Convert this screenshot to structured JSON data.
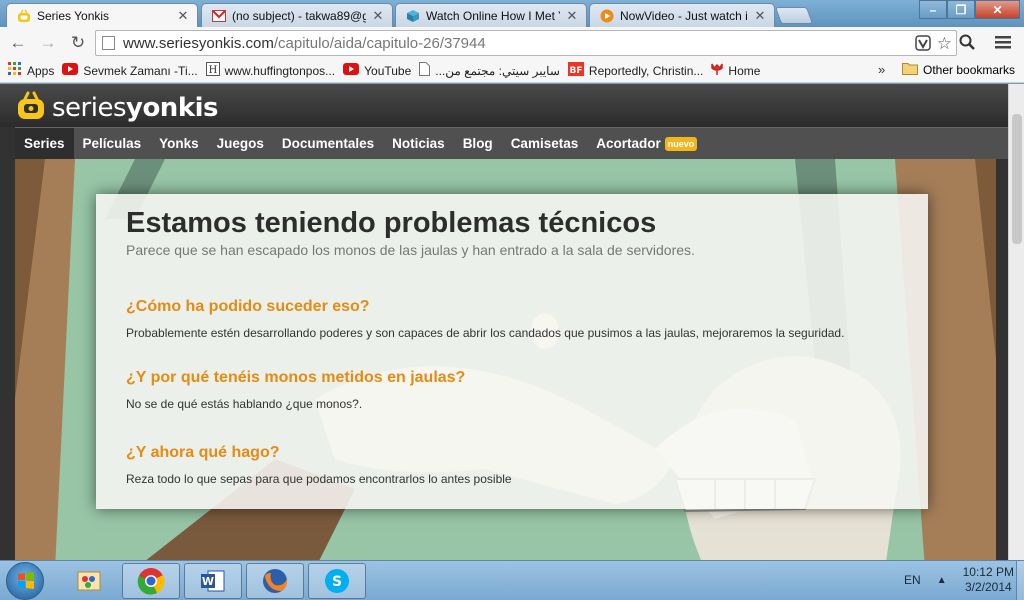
{
  "browser": {
    "tabs": [
      {
        "title": "Series Yonkis",
        "icon": "seriesyonkis-favicon",
        "active": true
      },
      {
        "title": "(no subject) - takwa89@g",
        "icon": "gmail-icon",
        "active": false
      },
      {
        "title": "Watch Online How I Met Y",
        "icon": "box-icon",
        "active": false
      },
      {
        "title": "NowVideo - Just watch it",
        "icon": "play-icon",
        "active": false
      }
    ],
    "url_host": "www.seriesyonkis.com",
    "url_path": "/capitulo/aida/capitulo-26/37944",
    "bookmarks": [
      {
        "label": "Apps",
        "icon": "apps-grid-icon"
      },
      {
        "label": "Sevmek Zamanı -Ti...",
        "icon": "youtube-icon"
      },
      {
        "label": "www.huffingtonpos...",
        "icon": "huffpost-icon"
      },
      {
        "label": "YouTube",
        "icon": "youtube-icon"
      },
      {
        "label": "سايبر سيتي: مجتمع من...",
        "icon": "page-icon"
      },
      {
        "label": "Reportedly, Christin...",
        "icon": "bf-icon"
      },
      {
        "label": "Home",
        "icon": "tulip-icon"
      }
    ],
    "bookmarks_overflow": "»",
    "other_bookmarks": "Other bookmarks"
  },
  "site": {
    "logo_light": "series",
    "logo_bold": "yonkis",
    "nav": [
      {
        "label": "Series",
        "active": true
      },
      {
        "label": "Películas"
      },
      {
        "label": "Yonks"
      },
      {
        "label": "Juegos"
      },
      {
        "label": "Documentales"
      },
      {
        "label": "Noticias"
      },
      {
        "label": "Blog"
      },
      {
        "label": "Camisetas"
      },
      {
        "label": "Acortador",
        "badge": "nuevo"
      }
    ],
    "error": {
      "title": "Estamos teniendo problemas técnicos",
      "subtitle": "Parece que se han escapado los monos de las jaulas y han entrado a la sala de servidores.",
      "q1": "¿Cómo ha podido suceder eso?",
      "a1": "Probablemente estén desarrollando poderes y son capaces de abrir los candados que pusimos a las jaulas, mejoraremos la seguridad.",
      "q2": "¿Y por qué tenéis monos metidos en jaulas?",
      "a2": "No se de qué estás hablando ¿que monos?.",
      "q3": "¿Y ahora qué hago?",
      "a3": "Reza todo lo que sepas para que podamos encontrarlos lo antes posible"
    }
  },
  "taskbar": {
    "apps": [
      "paint-icon",
      "chrome-icon",
      "word-icon",
      "firefox-icon",
      "skype-icon"
    ],
    "language": "EN",
    "time": "10:12 PM",
    "date": "3/2/2014"
  },
  "colors": {
    "accent_orange": "#e58b14",
    "badge_yellow": "#f3b51c",
    "logo_yellow": "#f7c619"
  }
}
